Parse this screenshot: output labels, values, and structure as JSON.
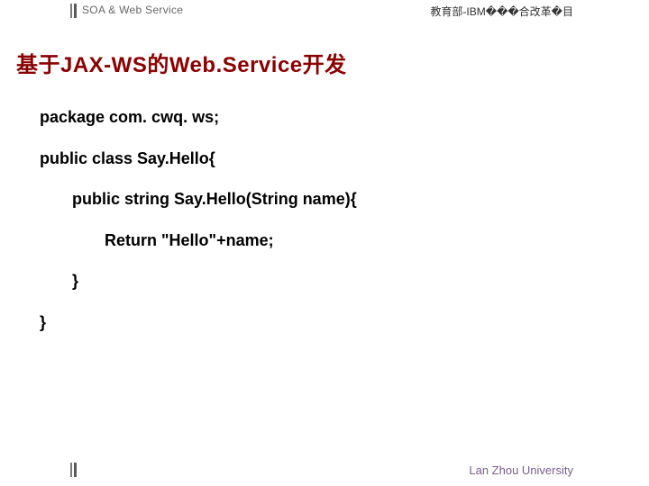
{
  "header": {
    "left": "SOA & Web Service",
    "right": "教育部-IBM���合改革�目"
  },
  "title": "基于JAX-WS的Web.Service开发",
  "code": {
    "lines": [
      "package com. cwq. ws;",
      "public class Say.Hello{",
      "public string Say.Hello(String name){",
      "Return \"Hello\"+name;",
      "}",
      "}"
    ]
  },
  "footer": {
    "text": "Lan Zhou University"
  }
}
